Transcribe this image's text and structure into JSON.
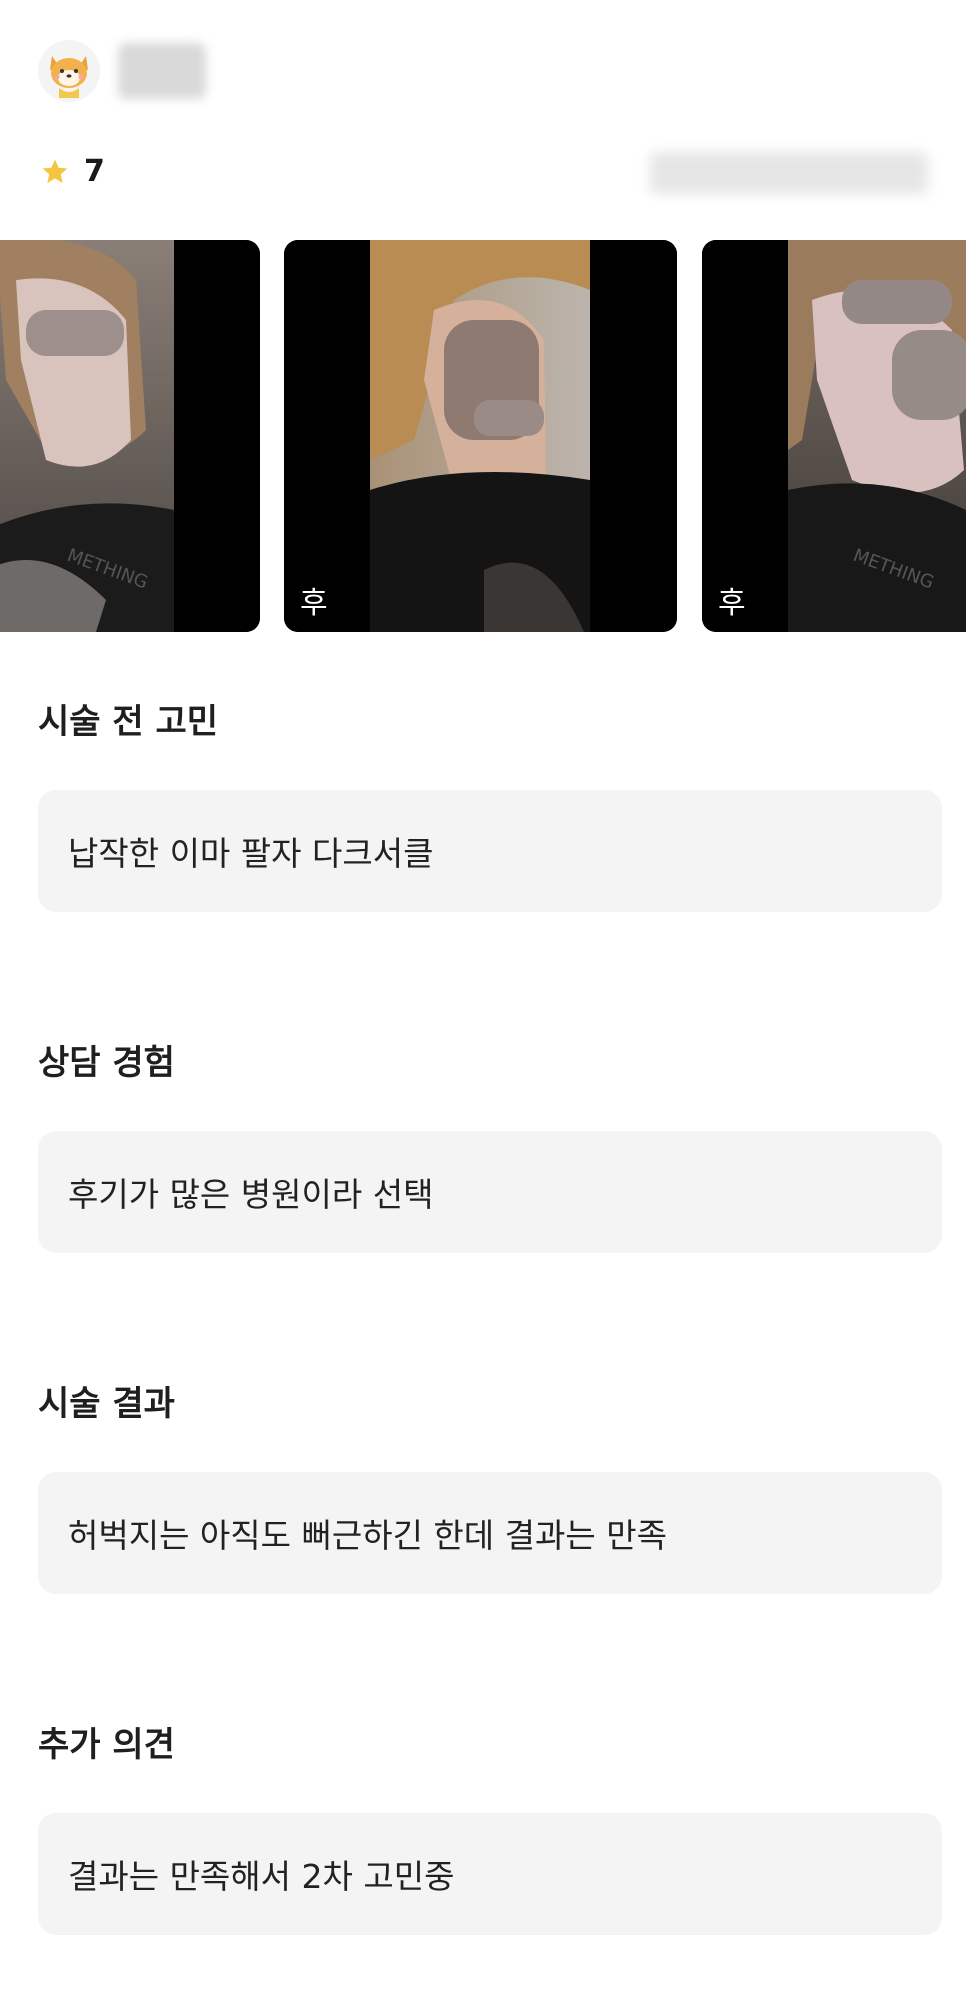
{
  "review": {
    "rating": "7",
    "star_color": "#f5c542",
    "photos": [
      {
        "label": ""
      },
      {
        "label": "후"
      },
      {
        "label": "후"
      }
    ]
  },
  "sections": [
    {
      "title": "시술 전 고민",
      "answer": "납작한 이마 팔자 다크서클"
    },
    {
      "title": "상담 경험",
      "answer": "후기가 많은 병원이라 선택"
    },
    {
      "title": "시술 결과",
      "answer": "허벅지는 아직도 뻐근하긴 한데 결과는 만족"
    },
    {
      "title": "추가 의견",
      "answer": "결과는 만족해서 2차 고민중"
    }
  ]
}
